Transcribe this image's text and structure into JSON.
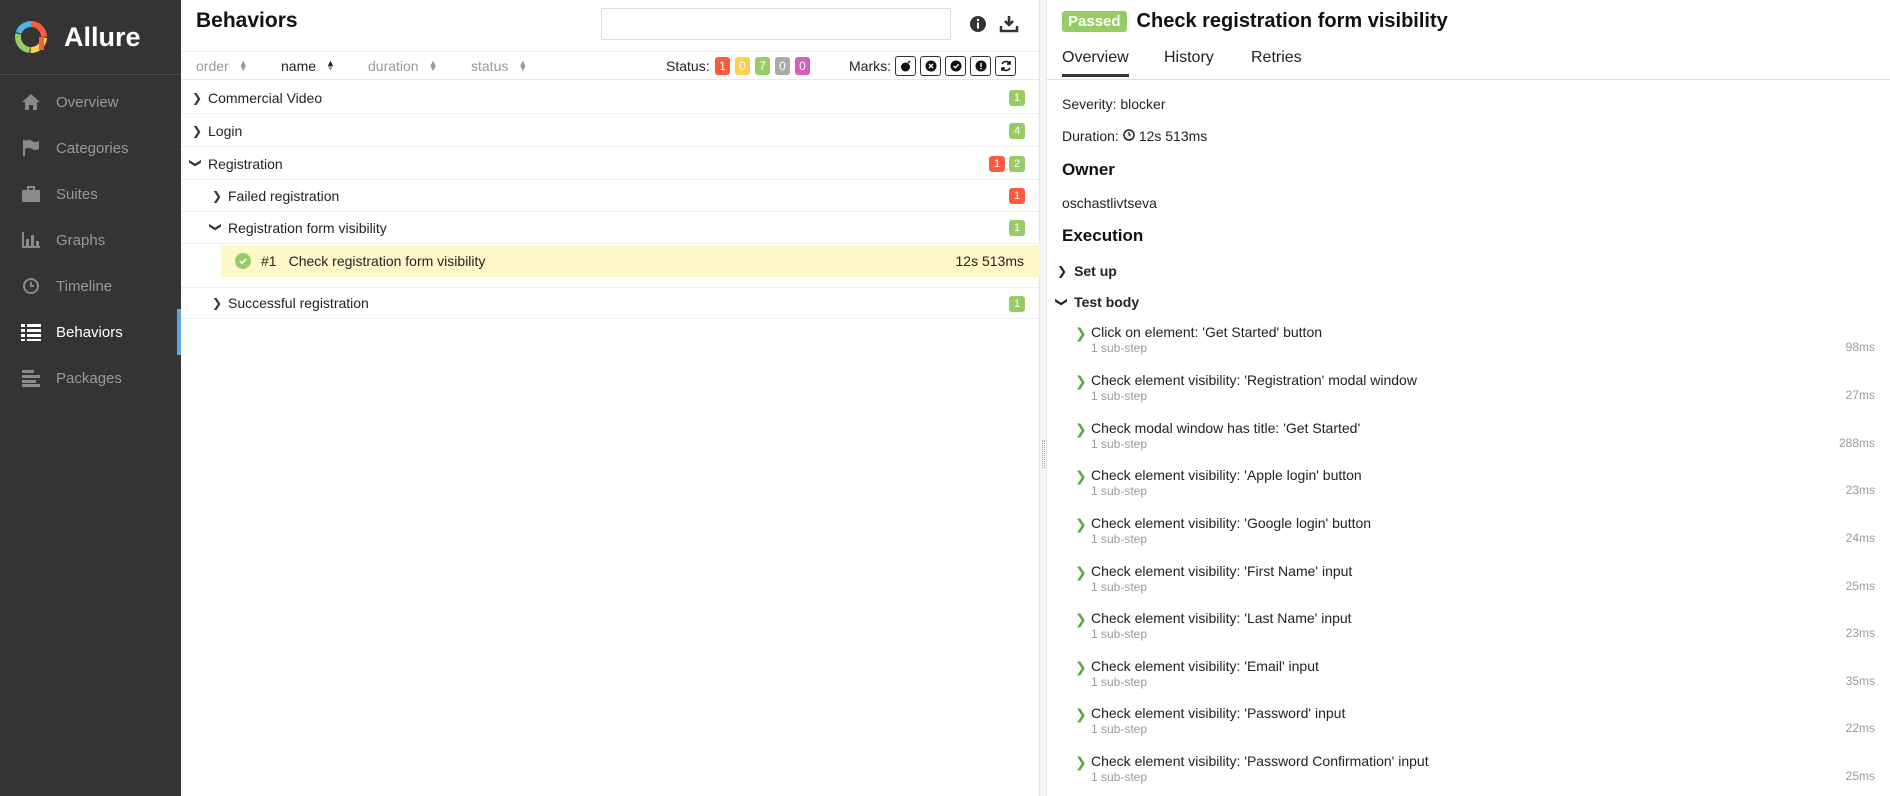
{
  "app": {
    "name": "Allure"
  },
  "sidebar": {
    "items": [
      {
        "label": "Overview",
        "icon": "home-icon"
      },
      {
        "label": "Categories",
        "icon": "flag-icon"
      },
      {
        "label": "Suites",
        "icon": "briefcase-icon"
      },
      {
        "label": "Graphs",
        "icon": "bar-chart-icon"
      },
      {
        "label": "Timeline",
        "icon": "clock-icon"
      },
      {
        "label": "Behaviors",
        "icon": "list-icon",
        "active": true
      },
      {
        "label": "Packages",
        "icon": "align-left-icon"
      }
    ]
  },
  "behaviors": {
    "title": "Behaviors",
    "search": {
      "value": "",
      "placeholder": ""
    },
    "sort": {
      "order": "order",
      "name": "name",
      "duration": "duration",
      "status": "status"
    },
    "status_label": "Status:",
    "counters": [
      {
        "value": "1",
        "color": "#fd5a3e"
      },
      {
        "value": "0",
        "color": "#ffd050"
      },
      {
        "value": "7",
        "color": "#97cc64"
      },
      {
        "value": "0",
        "color": "#aaaaaa"
      },
      {
        "value": "0",
        "color": "#d35ebe"
      }
    ],
    "marks_label": "Marks:",
    "tree": [
      {
        "label": "Commercial Video",
        "failed": "",
        "passed": "1"
      },
      {
        "label": "Login",
        "failed": "",
        "passed": "4"
      },
      {
        "label": "Registration",
        "failed": "1",
        "passed": "2"
      },
      {
        "label": "Failed registration",
        "failed": "1",
        "passed": ""
      },
      {
        "label": "Registration form visibility",
        "failed": "",
        "passed": "1"
      },
      {
        "label": "Successful registration",
        "failed": "",
        "passed": "1"
      }
    ],
    "case": {
      "num": "#1",
      "name": "Check registration form visibility",
      "duration": "12s 513ms"
    }
  },
  "detail": {
    "status": "Passed",
    "title": "Check registration form visibility",
    "tabs": [
      "Overview",
      "History",
      "Retries"
    ],
    "severity": "Severity: blocker",
    "duration_label": "Duration:",
    "duration": "12s 513ms",
    "owner_heading": "Owner",
    "owner": "oschastlivtseva",
    "execution_heading": "Execution",
    "setup_label": "Set up",
    "body_label": "Test body",
    "steps": [
      {
        "name": "Click on element: 'Get Started' button",
        "sub": "1 sub-step",
        "duration": "98ms"
      },
      {
        "name": "Check element visibility: 'Registration' modal window",
        "sub": "1 sub-step",
        "duration": "27ms"
      },
      {
        "name": "Check modal window has title: 'Get Started'",
        "sub": "1 sub-step",
        "duration": "288ms"
      },
      {
        "name": "Check element visibility: 'Apple login' button",
        "sub": "1 sub-step",
        "duration": "23ms"
      },
      {
        "name": "Check element visibility: 'Google login' button",
        "sub": "1 sub-step",
        "duration": "24ms"
      },
      {
        "name": "Check element visibility: 'First Name' input",
        "sub": "1 sub-step",
        "duration": "25ms"
      },
      {
        "name": "Check element visibility: 'Last Name' input",
        "sub": "1 sub-step",
        "duration": "23ms"
      },
      {
        "name": "Check element visibility: 'Email' input",
        "sub": "1 sub-step",
        "duration": "35ms"
      },
      {
        "name": "Check element visibility: 'Password' input",
        "sub": "1 sub-step",
        "duration": "22ms"
      },
      {
        "name": "Check element visibility: 'Password Confirmation' input",
        "sub": "1 sub-step",
        "duration": "25ms"
      }
    ]
  }
}
